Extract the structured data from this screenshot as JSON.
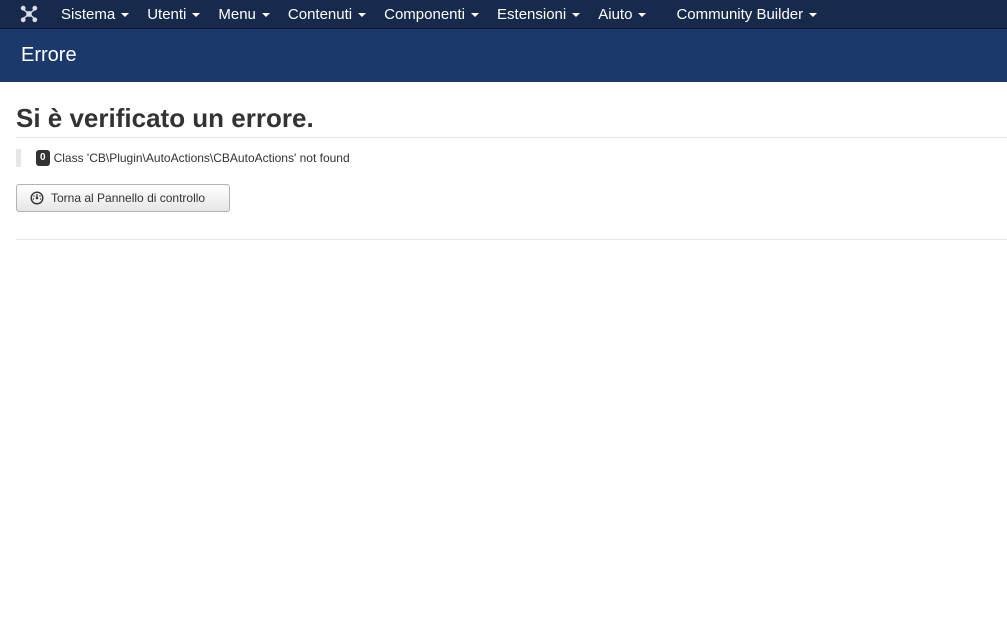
{
  "navbar": {
    "logo_icon": "joomla-logo-icon",
    "items": [
      {
        "label": "Sistema"
      },
      {
        "label": "Utenti"
      },
      {
        "label": "Menu"
      },
      {
        "label": "Contenuti"
      },
      {
        "label": "Componenti"
      },
      {
        "label": "Estensioni"
      },
      {
        "label": "Aiuto"
      },
      {
        "label": "Community Builder"
      }
    ],
    "background": "#172a4b"
  },
  "header": {
    "title": "Errore",
    "background": "#1b3a6b"
  },
  "error": {
    "heading": "Si è verificato un errore.",
    "code": "0",
    "message": "Class 'CB\\Plugin\\AutoActions\\CBAutoActions' not found"
  },
  "actions": {
    "back_button_label": "Torna al Pannello di controllo",
    "back_button_icon": "dashboard-icon"
  }
}
